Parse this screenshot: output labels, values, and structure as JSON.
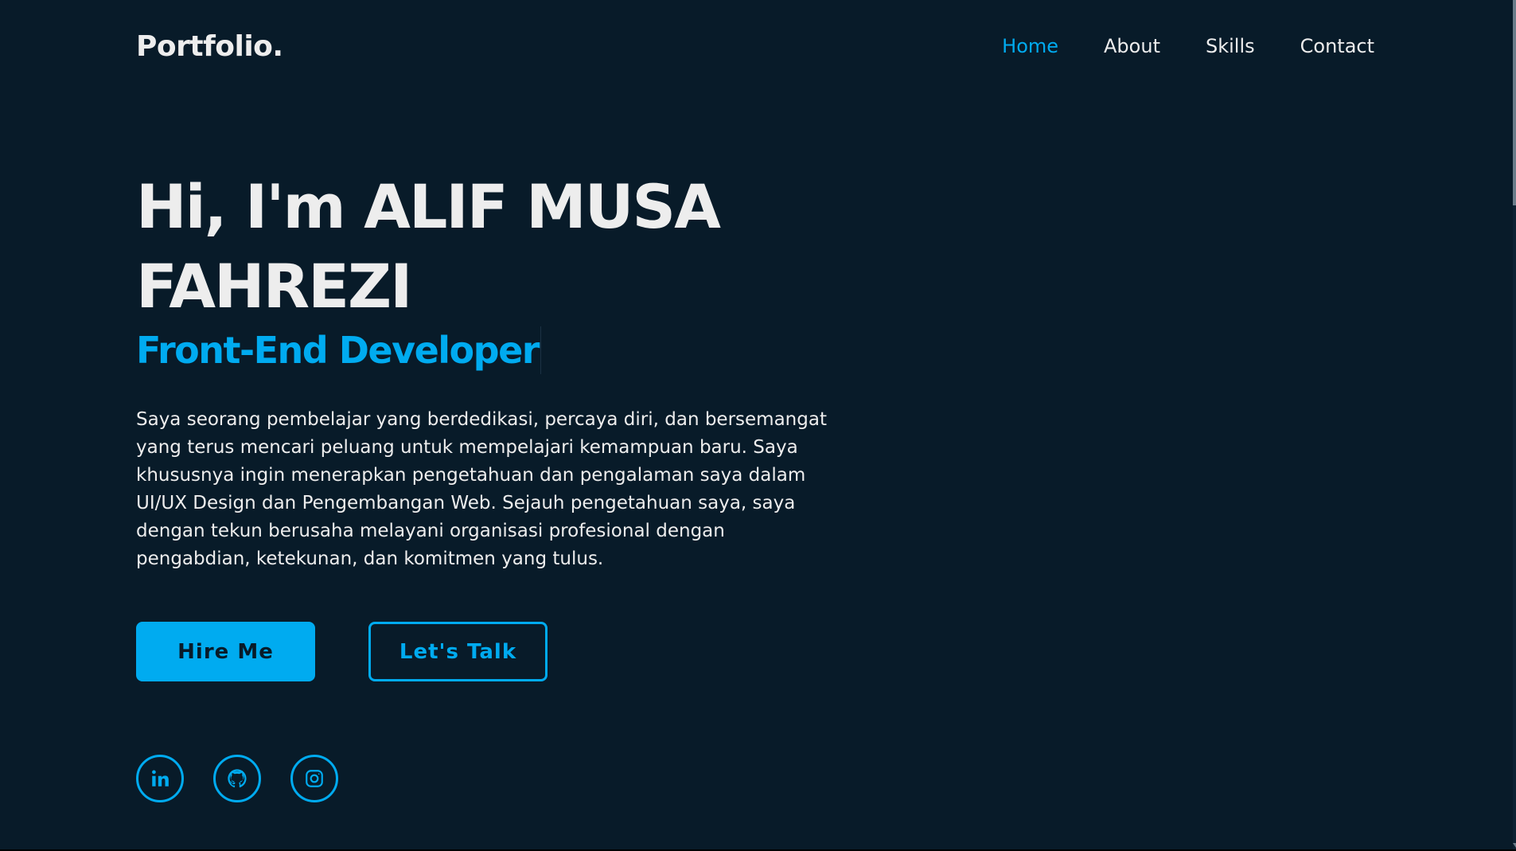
{
  "brand": {
    "logo": "Portfolio."
  },
  "nav": {
    "items": [
      {
        "label": "Home",
        "active": true
      },
      {
        "label": "About",
        "active": false
      },
      {
        "label": "Skills",
        "active": false
      },
      {
        "label": "Contact",
        "active": false
      }
    ]
  },
  "hero": {
    "title_line1": "Hi, I'm ALIF MUSA",
    "title_line2": "FAHREZI",
    "role": "Front-End Developer",
    "description": "Saya seorang pembelajar yang berdedikasi, percaya diri, dan bersemangat yang terus mencari peluang untuk mempelajari kemampuan baru. Saya khususnya ingin menerapkan pengetahuan dan pengalaman saya dalam UI/UX Design dan Pengembangan Web. Sejauh pengetahuan saya, saya dengan tekun berusaha melayani organisasi profesional dengan pengabdian, ketekunan, dan komitmen yang tulus."
  },
  "buttons": {
    "hire": "Hire Me",
    "talk": "Let's Talk"
  },
  "socials": [
    {
      "icon": "linkedin-icon"
    },
    {
      "icon": "github-icon"
    },
    {
      "icon": "instagram-icon"
    }
  ],
  "colors": {
    "background": "#081b29",
    "accent": "#00abf0",
    "text": "#ededed"
  }
}
